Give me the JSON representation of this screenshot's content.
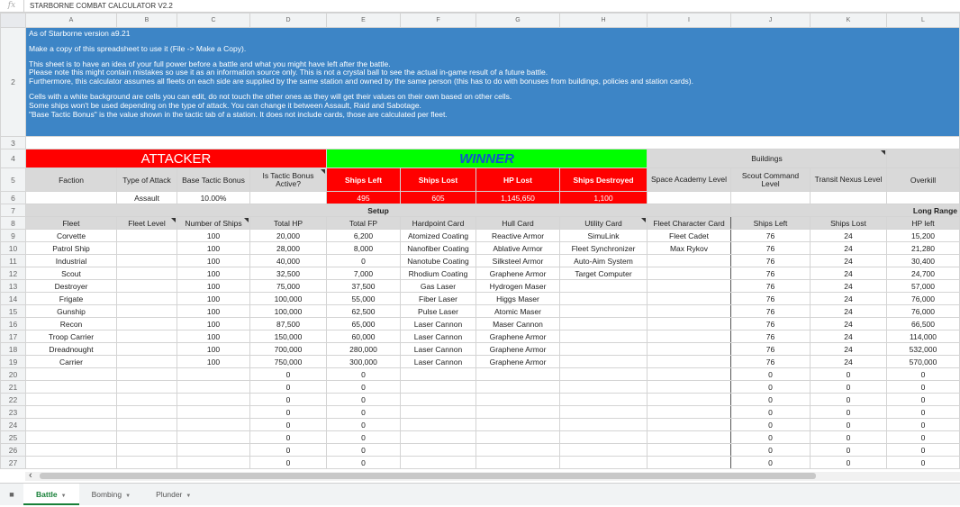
{
  "formula_bar": {
    "text": "STARBORNE COMBAT CALCULATOR V2.2"
  },
  "column_letters": [
    "A",
    "B",
    "C",
    "D",
    "E",
    "F",
    "G",
    "H",
    "I",
    "J",
    "K",
    "L"
  ],
  "row_numbers": [
    "2",
    "3",
    "4",
    "5",
    "6",
    "7",
    "8",
    "9",
    "10",
    "11",
    "12",
    "13",
    "14",
    "15",
    "16",
    "17",
    "18",
    "19",
    "20",
    "21",
    "22",
    "23",
    "24",
    "25",
    "26",
    "27"
  ],
  "info_lines": [
    "As of Starborne version a9.21",
    "",
    "Make a copy of this spreadsheet to use it (File -> Make a Copy).",
    "",
    "This sheet is to have an idea of your full power before a battle and what you might have left after the battle.",
    "Please note this might contain mistakes so use it as an information source only. This is not a crystal ball to see the actual in-game result of a future battle.",
    "Furthermore, this calculator assumes all fleets on each side are supplied by the same station and owned by the same person (this has to do with bonuses from buildings, policies and station cards).",
    "",
    "Cells with a white background are cells you can edit, do not touch the other ones as they will get their values on their own based on other cells.",
    "Some ships won't be used depending on the type of attack. You can change it between Assault, Raid and Sabotage.",
    "\"Base Tactic Bonus\" is the value shown in the tactic tab of a station. It does not include cards, those are calculated per fleet."
  ],
  "banner": {
    "attacker": "ATTACKER",
    "winner": "WINNER",
    "buildings": "Buildings"
  },
  "row5_labels": {
    "faction": "Faction",
    "type_of_attack": "Type of Attack",
    "base_tactic_bonus": "Base Tactic Bonus",
    "tactic_bonus_active": "Is Tactic Bonus Active?",
    "ships_left": "Ships Left",
    "ships_lost": "Ships Lost",
    "hp_lost": "HP Lost",
    "ships_destroyed": "Ships Destroyed",
    "space_academy": "Space Academy Level",
    "scout_command": "Scout Command Level",
    "transit_nexus": "Transit Nexus Level",
    "overkill": "Overkill"
  },
  "row6_values": {
    "type_of_attack": "Assault",
    "base_tactic_bonus": "10.00%",
    "ships_left": "495",
    "ships_lost": "605",
    "hp_lost": "1,145,650",
    "ships_destroyed": "1,100"
  },
  "section_labels": {
    "setup": "Setup",
    "long_range": "Long Range"
  },
  "fleet_headers": [
    "Fleet",
    "Fleet Level",
    "Number of Ships",
    "Total HP",
    "Total FP",
    "Hardpoint Card",
    "Hull Card",
    "Utility Card",
    "Fleet Character Card",
    "Ships Left",
    "Ships Lost",
    "HP left"
  ],
  "fleet_rows": [
    [
      "Corvette",
      "",
      "100",
      "20,000",
      "6,200",
      "Atomized Coating",
      "Reactive Armor",
      "SimuLink",
      "Fleet Cadet",
      "76",
      "24",
      "15,200"
    ],
    [
      "Patrol Ship",
      "",
      "100",
      "28,000",
      "8,000",
      "Nanofiber Coating",
      "Ablative Armor",
      "Fleet Synchronizer",
      "Max Rykov",
      "76",
      "24",
      "21,280"
    ],
    [
      "Industrial",
      "",
      "100",
      "40,000",
      "0",
      "Nanotube Coating",
      "Silksteel Armor",
      "Auto-Aim System",
      "",
      "76",
      "24",
      "30,400"
    ],
    [
      "Scout",
      "",
      "100",
      "32,500",
      "7,000",
      "Rhodium Coating",
      "Graphene Armor",
      "Target Computer",
      "",
      "76",
      "24",
      "24,700"
    ],
    [
      "Destroyer",
      "",
      "100",
      "75,000",
      "37,500",
      "Gas Laser",
      "Hydrogen Maser",
      "",
      "",
      "76",
      "24",
      "57,000"
    ],
    [
      "Frigate",
      "",
      "100",
      "100,000",
      "55,000",
      "Fiber Laser",
      "Higgs Maser",
      "",
      "",
      "76",
      "24",
      "76,000"
    ],
    [
      "Gunship",
      "",
      "100",
      "100,000",
      "62,500",
      "Pulse Laser",
      "Atomic Maser",
      "",
      "",
      "76",
      "24",
      "76,000"
    ],
    [
      "Recon",
      "",
      "100",
      "87,500",
      "65,000",
      "Laser Cannon",
      "Maser Cannon",
      "",
      "",
      "76",
      "24",
      "66,500"
    ],
    [
      "Troop Carrier",
      "",
      "100",
      "150,000",
      "60,000",
      "Laser Cannon",
      "Graphene Armor",
      "",
      "",
      "76",
      "24",
      "114,000"
    ],
    [
      "Dreadnought",
      "",
      "100",
      "700,000",
      "280,000",
      "Laser Cannon",
      "Graphene Armor",
      "",
      "",
      "76",
      "24",
      "532,000"
    ],
    [
      "Carrier",
      "",
      "100",
      "750,000",
      "300,000",
      "Laser Cannon",
      "Graphene Armor",
      "",
      "",
      "76",
      "24",
      "570,000"
    ],
    [
      "",
      "",
      "",
      "0",
      "0",
      "",
      "",
      "",
      "",
      "0",
      "0",
      "0"
    ],
    [
      "",
      "",
      "",
      "0",
      "0",
      "",
      "",
      "",
      "",
      "0",
      "0",
      "0"
    ],
    [
      "",
      "",
      "",
      "0",
      "0",
      "",
      "",
      "",
      "",
      "0",
      "0",
      "0"
    ],
    [
      "",
      "",
      "",
      "0",
      "0",
      "",
      "",
      "",
      "",
      "0",
      "0",
      "0"
    ],
    [
      "",
      "",
      "",
      "0",
      "0",
      "",
      "",
      "",
      "",
      "0",
      "0",
      "0"
    ],
    [
      "",
      "",
      "",
      "0",
      "0",
      "",
      "",
      "",
      "",
      "0",
      "0",
      "0"
    ],
    [
      "",
      "",
      "",
      "0",
      "0",
      "",
      "",
      "",
      "",
      "0",
      "0",
      "0"
    ],
    [
      "",
      "",
      "",
      "0",
      "0",
      "",
      "",
      "",
      "",
      "0",
      "0",
      "0"
    ]
  ],
  "sheet_tabs": [
    {
      "label": "Battle"
    },
    {
      "label": "Bombing"
    },
    {
      "label": "Plunder"
    }
  ],
  "colors": {
    "info_bg": "#3d85c6",
    "attacker": "#ff0000",
    "winner_bg": "#00ff00",
    "winner_text": "#1155cc",
    "active_tab": "#188038"
  }
}
